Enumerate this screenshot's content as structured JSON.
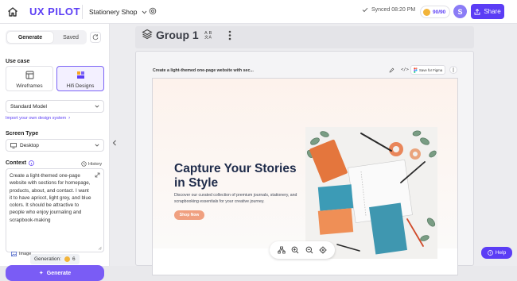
{
  "topbar": {
    "logo": "UX PILOT",
    "project": "Stationery Shop",
    "sync_status": "Synced 08:20 PM",
    "credits": "90/90",
    "avatar_initial": "S",
    "share_label": "Share"
  },
  "sidebar": {
    "tabs": [
      "Generate",
      "Saved"
    ],
    "use_case_label": "Use case",
    "use_cases": [
      "Wireframes",
      "Hifi Designs"
    ],
    "model": "Standard Model",
    "import_link": "Import your own design system",
    "screen_type_label": "Screen Type",
    "screen_type": "Desktop",
    "context_label": "Context",
    "history_label": "History",
    "context_text": "Create a light-themed one-page website with sections for homepage, products, about, and contact. I want it to have apricot, light grey, and blue colors. It should be attractive to people who enjoy journaling and scrapbook-making",
    "image_label": "Image",
    "generation_label": "Generation:",
    "generation_count": "6",
    "generate_label": "Generate"
  },
  "canvas": {
    "group_title": "Group 1",
    "frame_caption": "Create a light-themed one-page website with sec...",
    "save_figma_label": "Save for Figma",
    "hero_title": "Capture Your Stories in Style",
    "hero_subtitle": "Discover our curated collection of premium journals, stationery, and scrapbooking essentials for your creative journey.",
    "hero_button": "Shop Now",
    "help_label": "Help"
  },
  "colors": {
    "brand": "#5b3df5",
    "apricot": "#f0a080",
    "navy": "#1e2b4a",
    "teal": "#3c9bb6",
    "orange": "#e4763d"
  }
}
